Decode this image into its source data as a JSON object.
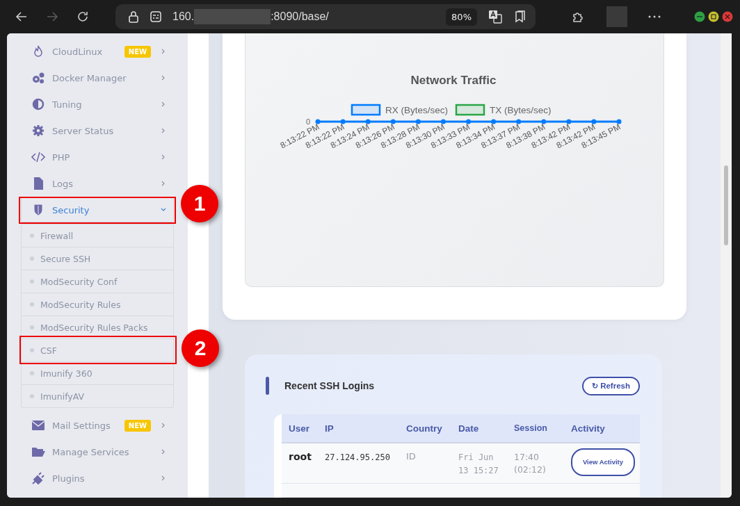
{
  "browser": {
    "nav": [
      {
        "kind": "back",
        "disabled": false
      },
      {
        "kind": "forward",
        "disabled": true
      },
      {
        "kind": "reload",
        "disabled": false
      }
    ],
    "url_prefix": "160.",
    "url_suffix": ":8090/base/",
    "zoom": "80%"
  },
  "sidebar": {
    "items": [
      {
        "label": "CloudLinux",
        "badge": "NEW",
        "selected": false,
        "expanded": false
      },
      {
        "label": "Docker Manager",
        "selected": false,
        "expanded": false
      },
      {
        "label": "Tuning",
        "selected": false,
        "expanded": false
      },
      {
        "label": "Server Status",
        "selected": false,
        "expanded": false
      },
      {
        "label": "PHP",
        "selected": false,
        "expanded": false
      },
      {
        "label": "Logs",
        "selected": false,
        "expanded": false
      },
      {
        "label": "Security",
        "selected": true,
        "expanded": true,
        "callout": "1",
        "children": [
          {
            "label": "Firewall",
            "selected": false
          },
          {
            "label": "Secure SSH",
            "selected": false
          },
          {
            "label": "ModSecurity Conf",
            "selected": false
          },
          {
            "label": "ModSecurity Rules",
            "selected": false
          },
          {
            "label": "ModSecurity Rules Packs",
            "selected": false
          },
          {
            "label": "CSF",
            "selected": false,
            "callout": "2"
          },
          {
            "label": "Imunify 360",
            "selected": false
          },
          {
            "label": "ImunifyAV",
            "selected": false
          }
        ]
      },
      {
        "label": "Mail Settings",
        "badge": "NEW",
        "selected": false,
        "expanded": false
      },
      {
        "label": "Manage Services",
        "selected": false,
        "expanded": false
      },
      {
        "label": "Plugins",
        "selected": false,
        "expanded": false
      }
    ]
  },
  "traffic": {
    "title": "Network Traffic",
    "legend": [
      {
        "label": "RX (Bytes/sec)",
        "color": "#007bff"
      },
      {
        "label": "TX (Bytes/sec)",
        "color": "#28a745"
      }
    ],
    "y_tick": "0",
    "x_labels": [
      "8:13:22 PM",
      "8:13:22 PM",
      "8:13:24 PM",
      "8:13:26 PM",
      "8:13:28 PM",
      "8:13:30 PM",
      "8:13:33 PM",
      "8:13:34 PM",
      "8:13:37 PM",
      "8:13:38 PM",
      "8:13:42 PM",
      "8:13:42 PM",
      "8:13:45 PM"
    ]
  },
  "ssh_logins": {
    "title": "Recent SSH Logins",
    "refresh": "Refresh",
    "refresh_icon": "↻",
    "columns": [
      "User",
      "IP",
      "Country",
      "Date",
      "Session",
      "Activity"
    ],
    "rows": [
      {
        "user": "root",
        "ip": "27.124.95.250",
        "country": "ID",
        "date": "Fri Jun 13 15:27",
        "session": "17:40 (02:12)",
        "action": "View Activity"
      }
    ]
  }
}
